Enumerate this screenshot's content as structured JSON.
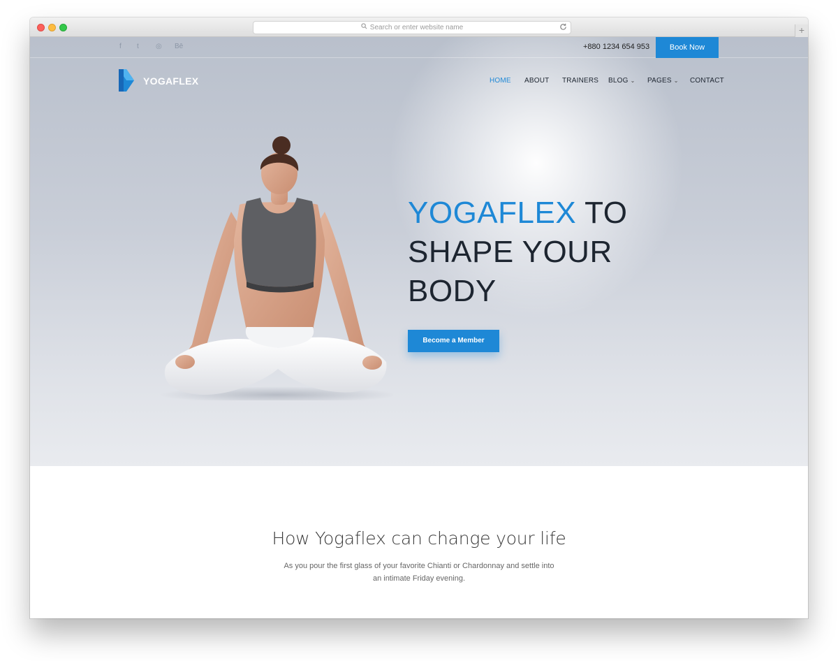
{
  "browser": {
    "address_placeholder": "Search or enter website name",
    "new_tab_label": "+"
  },
  "topbar": {
    "social_icons": [
      {
        "name": "facebook-icon",
        "glyph": "f"
      },
      {
        "name": "twitter-icon",
        "glyph": "t"
      },
      {
        "name": "dribbble-icon",
        "glyph": "◎"
      },
      {
        "name": "behance-icon",
        "glyph": "Bē"
      }
    ],
    "phone": "+880 1234 654 953",
    "book_label": "Book Now"
  },
  "brand": {
    "name": "YOGAFLEX",
    "accent_color": "#1e88d6"
  },
  "nav": [
    {
      "label": "HOME",
      "active": true
    },
    {
      "label": "ABOUT"
    },
    {
      "label": "TRAINERS"
    },
    {
      "label": "BLOG",
      "dropdown": true
    },
    {
      "label": "PAGES",
      "dropdown": true
    },
    {
      "label": "CONTACT"
    }
  ],
  "hero": {
    "headline_accent": "YOGAFLEX",
    "headline_rest_1": " TO",
    "headline_line_2": "SHAPE YOUR",
    "headline_line_3": "BODY",
    "cta_label": "Become a Member"
  },
  "section": {
    "title": "How Yogaflex can change your life",
    "line_1": "As you pour the first glass of your favorite Chianti or Chardonnay and settle into",
    "line_2": "an intimate Friday evening."
  }
}
